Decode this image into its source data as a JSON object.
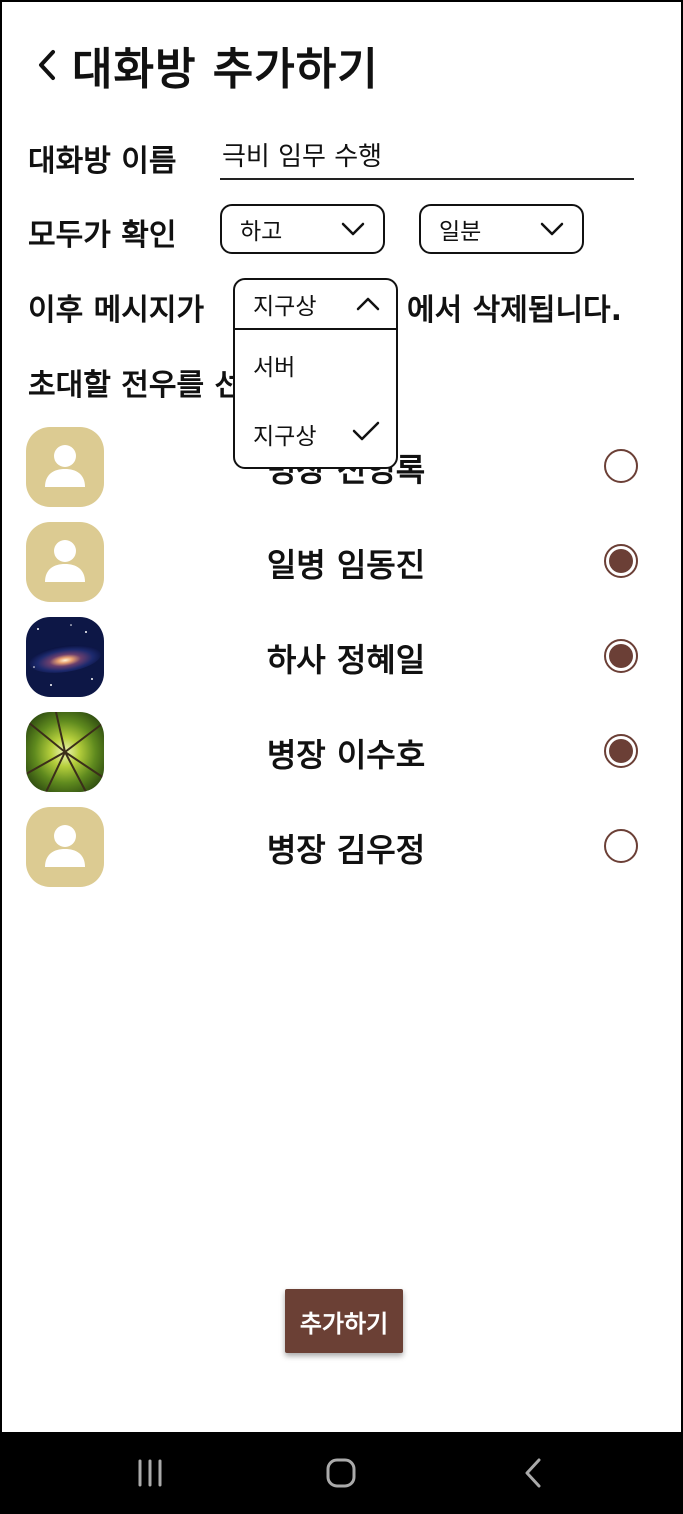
{
  "header": {
    "title": "대화방 추가하기",
    "back_icon": "chevron-left-icon"
  },
  "form": {
    "room_name_label": "대화방 이름",
    "room_name_value": "극비 임무 수행",
    "confirm_label": "모두가 확인",
    "confirm_action": "하고",
    "time_unit": "일분",
    "delete_prefix": "이후 메시지가",
    "delete_location": "지구상",
    "delete_suffix": "에서 삭제됩니다.",
    "invite_label": "초대할 전우를 선택하세요."
  },
  "dropdown": {
    "selected": "지구상",
    "options": [
      {
        "label": "서버",
        "checked": false
      },
      {
        "label": "지구상",
        "checked": true
      }
    ]
  },
  "members": [
    {
      "name": "병장 전영록",
      "avatar": "default-person-icon",
      "selected": false
    },
    {
      "name": "일병 임동진",
      "avatar": "default-person-icon",
      "selected": true
    },
    {
      "name": "하사 정혜일",
      "avatar": "galaxy-photo",
      "selected": true
    },
    {
      "name": "병장 이수호",
      "avatar": "forest-photo",
      "selected": true
    },
    {
      "name": "병장 김우정",
      "avatar": "default-person-icon",
      "selected": false
    }
  ],
  "add_button_label": "추가하기",
  "colors": {
    "accent": "#6b4035",
    "avatar_bg": "#dccb92",
    "radio": "#6b3f36"
  },
  "navbar": {
    "icons": [
      "recent-apps-icon",
      "home-icon",
      "back-icon"
    ]
  }
}
